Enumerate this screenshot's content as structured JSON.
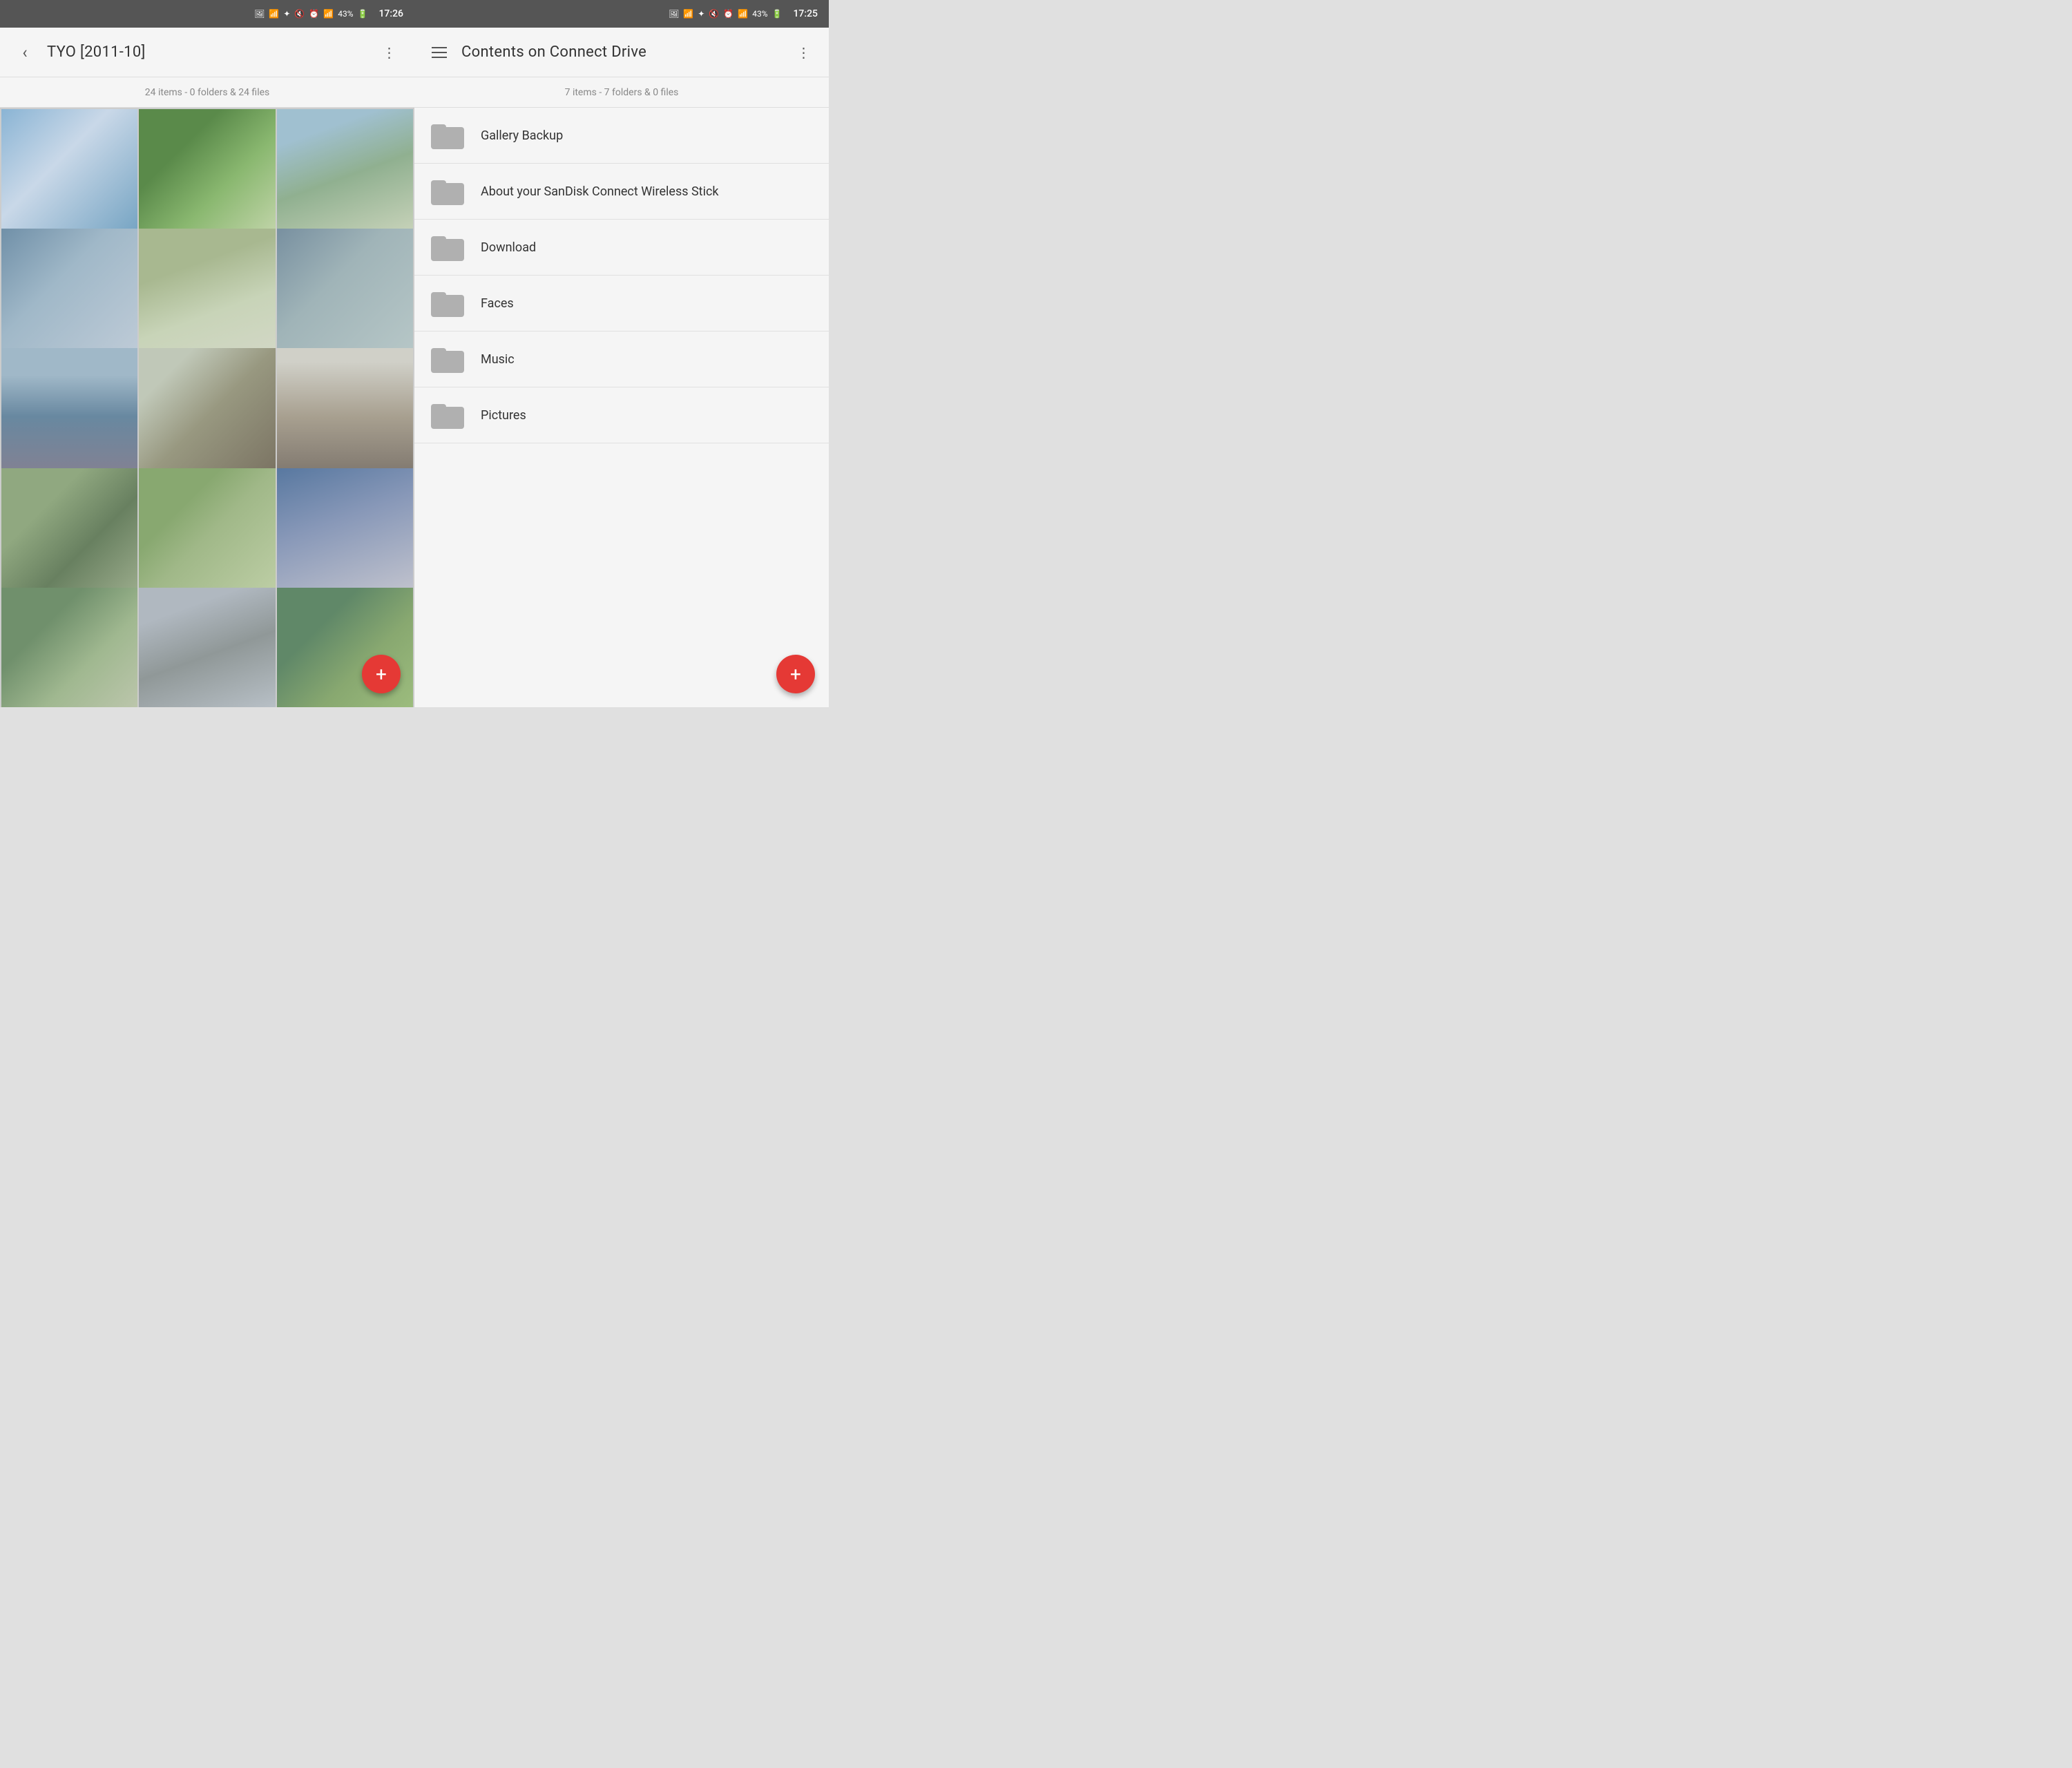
{
  "left_panel": {
    "status": {
      "icons": "🔵 📶 ⏰ 📶 📶 43% 🔋",
      "time": "17:26",
      "battery": "43%"
    },
    "header": {
      "title": "TYO [2011-10]",
      "back_label": "‹",
      "menu_label": "⋮"
    },
    "subtitle": "24 items - 0 folders & 24 files",
    "photos": [
      {
        "id": "PI100728",
        "class": "photo-728"
      },
      {
        "id": "PI100748",
        "class": "photo-748"
      },
      {
        "id": "PI100757",
        "class": "photo-757"
      },
      {
        "id": "PI100763",
        "class": "photo-763"
      },
      {
        "id": "PI100775",
        "class": "photo-775"
      },
      {
        "id": "PI100787",
        "class": "photo-787"
      },
      {
        "id": "PI100793",
        "class": "photo-793"
      },
      {
        "id": "PI100799",
        "class": "photo-799"
      },
      {
        "id": "PI100809",
        "class": "photo-809"
      },
      {
        "id": "PI100818",
        "class": "photo-818"
      },
      {
        "id": "PI100827",
        "class": "photo-827"
      },
      {
        "id": "PI100833",
        "class": "photo-833"
      },
      {
        "id": "PI100842",
        "class": "photo-extra1"
      },
      {
        "id": "PI100851",
        "class": "photo-extra2"
      },
      {
        "id": "PI100860",
        "class": "photo-extra3"
      }
    ],
    "fab_label": "+"
  },
  "right_panel": {
    "status": {
      "time": "17:25",
      "battery": "43%"
    },
    "header": {
      "title": "Contents on Connect Drive",
      "menu_label": "⋮"
    },
    "subtitle": "7 items - 7 folders & 0 files",
    "folders": [
      {
        "name": "Gallery Backup"
      },
      {
        "name": "About your SanDisk Connect Wireless Stick"
      },
      {
        "name": "Download"
      },
      {
        "name": "Faces"
      },
      {
        "name": "Music"
      },
      {
        "name": "Pictures"
      }
    ],
    "fab_label": "+"
  }
}
